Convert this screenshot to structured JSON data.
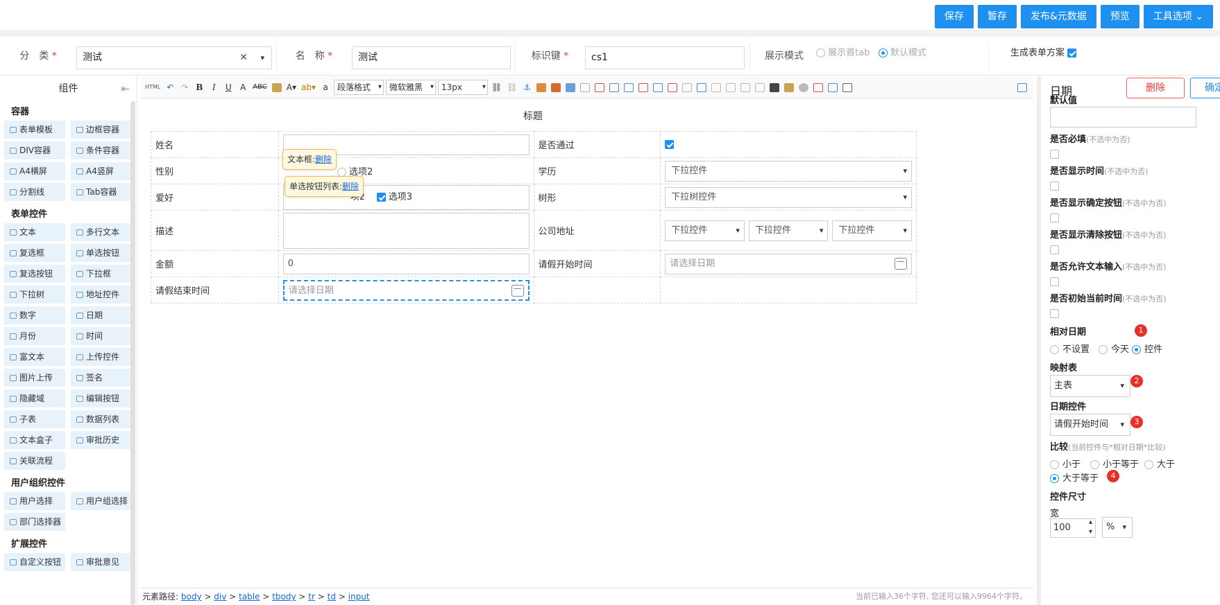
{
  "topbar": {
    "buttons": [
      "保存",
      "暂存",
      "发布&元数据",
      "预览",
      "工具选项 ⌄"
    ]
  },
  "meta": {
    "category_label": "分　类",
    "category_value": "测试",
    "name_label": "名　称",
    "name_value": "测试",
    "key_label": "标识键",
    "key_value": "cs1",
    "display_mode_label": "展示模式",
    "display_opt1": "展示首tab",
    "display_opt2": "默认模式",
    "gen_label": "生成表单方案",
    "required_mark": "*"
  },
  "left": {
    "title": "组件",
    "groups": [
      {
        "name": "容器",
        "items": [
          "表单模板",
          "边框容器",
          "DIV容器",
          "条件容器",
          "A4横屏",
          "A4竖屏",
          "分割线",
          "Tab容器"
        ]
      },
      {
        "name": "表单控件",
        "items": [
          "文本",
          "多行文本",
          "复选框",
          "单选按钮",
          "复选按钮",
          "下拉框",
          "下拉树",
          "地址控件",
          "数字",
          "日期",
          "月份",
          "时间",
          "富文本",
          "上传控件",
          "图片上传",
          "签名",
          "隐藏域",
          "编辑按钮",
          "子表",
          "数据列表",
          "文本盒子",
          "审批历史",
          "关联流程"
        ]
      },
      {
        "name": "用户组织控件",
        "items": [
          "用户选择",
          "用户组选择",
          "部门选择器"
        ]
      },
      {
        "name": "扩展控件",
        "items": [
          "自定义按钮",
          "审批意见"
        ]
      }
    ]
  },
  "toolbar": {
    "format": "段落格式",
    "font": "微软雅黑",
    "size": "13px"
  },
  "form": {
    "title": "标题",
    "name_label": "姓名",
    "passed_label": "是否通过",
    "gender_label": "性别",
    "option2": "选项2",
    "option3": "选项3",
    "option2_partial": "项2",
    "edu_label": "学历",
    "dropdown": "下拉控件",
    "hobby_label": "爱好",
    "tree_label": "树形",
    "tree_dropdown": "下拉树控件",
    "desc_label": "描述",
    "address_label": "公司地址",
    "amount_label": "金额",
    "amount_value": "0",
    "start_label": "请假开始时间",
    "date_placeholder": "请选择日期",
    "end_label": "请假结束时间",
    "tip1_text": "文本框:",
    "tip2_text": "单选按钮列表:",
    "delete": "删除"
  },
  "pathbar": {
    "label": "元素路径:",
    "path": [
      "body",
      "div",
      "table",
      "tbody",
      "tr",
      "td",
      "input"
    ],
    "sep": ">",
    "counter": "当前已输入36个字符, 您还可以输入9964个字符。"
  },
  "right": {
    "title": "日期",
    "delete": "删除",
    "confirm": "确定",
    "default_label": "默认值",
    "hint": "(不选中为否)",
    "required": "是否必填",
    "show_time": "是否显示时间",
    "show_ok": "是否显示确定按钮",
    "show_clear": "是否显示清除按钮",
    "allow_text": "是否允许文本输入",
    "init_now": "是否初始当前时间",
    "relative_label": "相对日期",
    "rel_opts": [
      "不设置",
      "今天",
      "控件"
    ],
    "map_label": "映射表",
    "map_value": "主表",
    "date_ctrl_label": "日期控件",
    "date_ctrl_value": "请假开始时间",
    "compare_label": "比较",
    "compare_hint": "(当前控件与*相对日期*比较)",
    "cmp_opts": [
      "小于",
      "小于等于",
      "大于",
      "大于等于"
    ],
    "size_label": "控件尺寸",
    "width_label": "宽",
    "width_value": "100",
    "unit_value": "%",
    "badges": [
      "1",
      "2",
      "3",
      "4"
    ]
  }
}
